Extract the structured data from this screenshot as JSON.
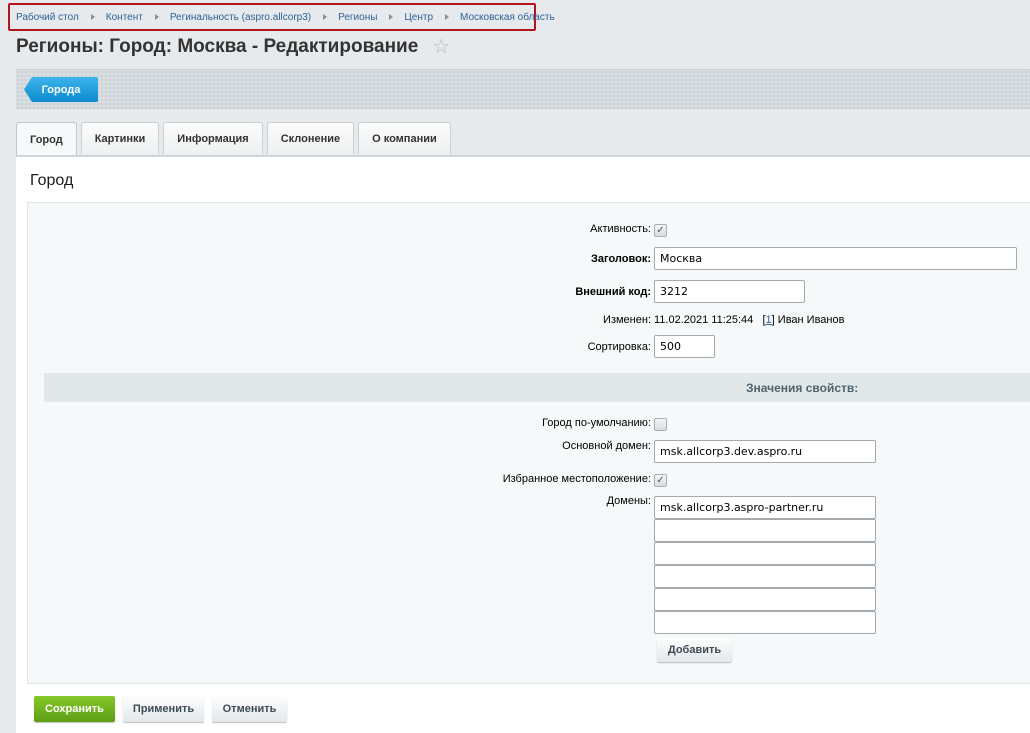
{
  "breadcrumb": [
    "Рабочий стол",
    "Контент",
    "Регинальность (aspro.allcorp3)",
    "Регионы",
    "Центр",
    "Московская область"
  ],
  "page_title": "Регионы: Город: Москва - Редактирование",
  "toolbar": {
    "back_label": "Города"
  },
  "tabs": [
    "Город",
    "Картинки",
    "Информация",
    "Склонение",
    "О компании"
  ],
  "active_tab": "Город",
  "section_title": "Город",
  "form": {
    "active_label": "Активность:",
    "active_checked": true,
    "title_label": "Заголовок:",
    "title_value": "Москва",
    "ext_code_label": "Внешний код:",
    "ext_code_value": "3212",
    "modified_label": "Изменен:",
    "modified_date": "11.02.2021 11:25:44",
    "modified_user_id": "1",
    "modified_user_name": "Иван Иванов",
    "sort_label": "Сортировка:",
    "sort_value": "500"
  },
  "props": {
    "header": "Значения свойств:",
    "default_city_label": "Город по-умолчанию:",
    "default_city_checked": false,
    "main_domain_label": "Основной домен:",
    "main_domain_value": "msk.allcorp3.dev.aspro.ru",
    "favorite_label": "Избранное местоположение:",
    "favorite_checked": true,
    "domains_label": "Домены:",
    "domains": [
      "msk.allcorp3.aspro-partner.ru",
      "",
      "",
      "",
      "",
      ""
    ],
    "add_label": "Добавить"
  },
  "buttons": {
    "save": "Сохранить",
    "apply": "Применить",
    "cancel": "Отменить"
  },
  "icons": {
    "star": "star-icon",
    "check": "checkmark-icon"
  },
  "colors": {
    "accent_blue": "#1a9ee0",
    "save_green": "#6fb320",
    "breadcrumb_highlight": "#b0151c"
  }
}
